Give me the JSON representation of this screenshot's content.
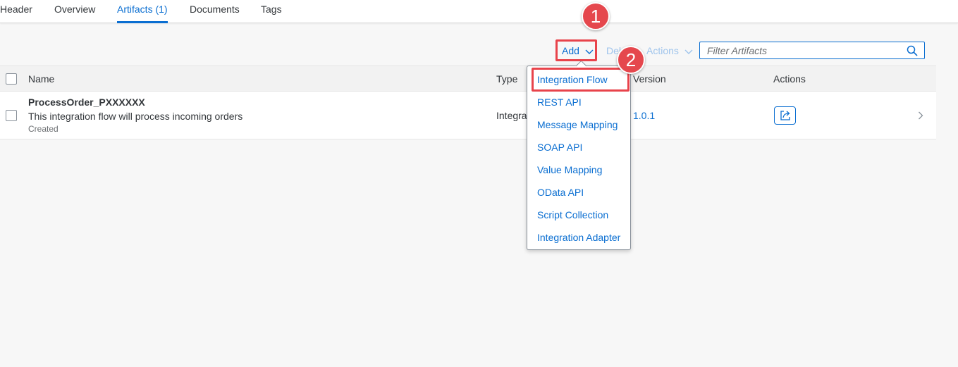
{
  "tabs": [
    {
      "label": "Header",
      "active": false
    },
    {
      "label": "Overview",
      "active": false
    },
    {
      "label": "Artifacts (1)",
      "active": true
    },
    {
      "label": "Documents",
      "active": false
    },
    {
      "label": "Tags",
      "active": false
    }
  ],
  "toolbar": {
    "add_label": "Add",
    "delete_label": "Delete",
    "actions_label": "Actions",
    "filter_placeholder": "Filter Artifacts",
    "filter_value": ""
  },
  "table": {
    "columns": {
      "name": "Name",
      "type": "Type",
      "version": "Version",
      "actions": "Actions"
    },
    "rows": [
      {
        "name": "ProcessOrder_PXXXXXX",
        "description": "This integration flow will process incoming orders",
        "status": "Created",
        "type": "Integration Flow",
        "version": "1.0.1"
      }
    ]
  },
  "add_menu": {
    "items": [
      "Integration Flow",
      "REST API",
      "Message Mapping",
      "SOAP API",
      "Value Mapping",
      "OData API",
      "Script Collection",
      "Integration Adapter"
    ]
  },
  "annotations": {
    "step1": "1",
    "step2": "2",
    "highlight_color": "#e8434b"
  },
  "icons": {
    "search": "search-icon",
    "chevron": "chevron-down-icon",
    "open": "open-in-new-icon",
    "navigation": "chevron-right-icon"
  },
  "colors": {
    "accent": "#0a6ed1",
    "disabled": "#9fc4ec",
    "badge": "#e5474d"
  }
}
